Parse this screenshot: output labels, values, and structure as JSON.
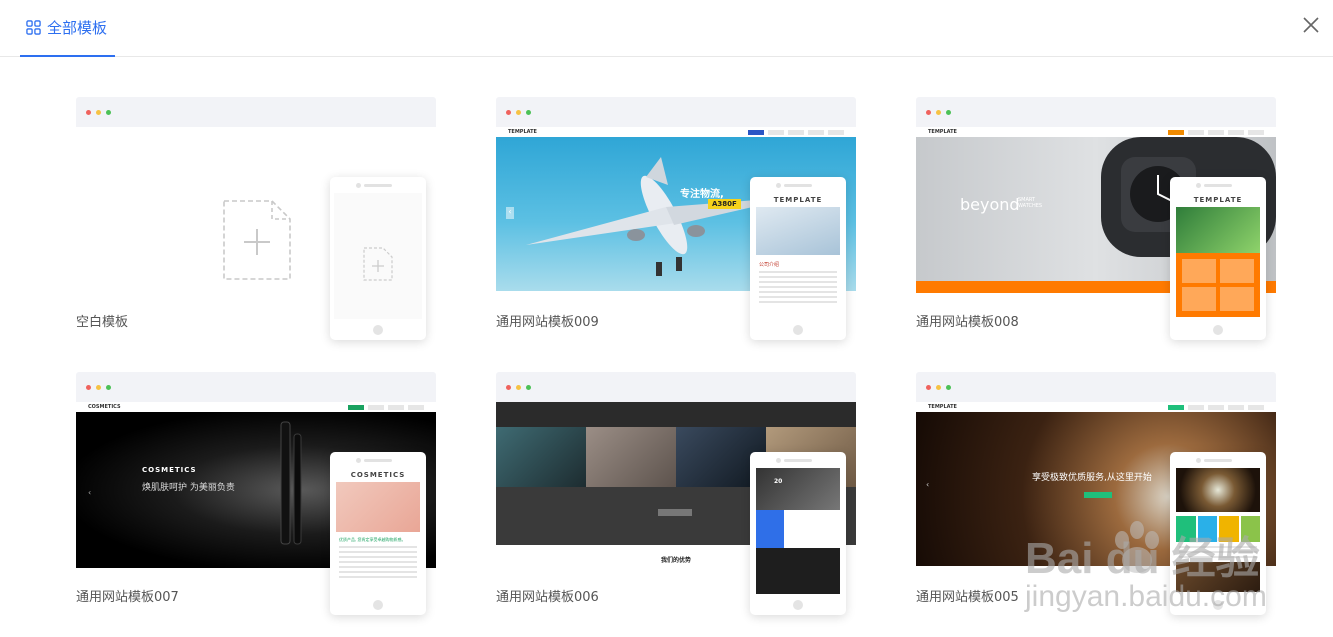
{
  "header": {
    "tab_label": "全部模板"
  },
  "templates": [
    {
      "label": "空白模板"
    },
    {
      "label": "通用网站模板009",
      "brand": "TEMPLATE",
      "hero_text": "专注物流,",
      "hero_tag": "A380F",
      "mobile_brand": "TEMPLATE",
      "mobile_heading": "公司介绍"
    },
    {
      "label": "通用网站模板008",
      "brand": "TEMPLATE",
      "hero_text": "beyond",
      "hero_sub": "SMART WATCHES",
      "mobile_brand": "TEMPLATE"
    },
    {
      "label": "通用网站模板007",
      "brand": "COSMETICS",
      "hero_title": "COSMETICS",
      "hero_text": "焕肌肤呵护 为美丽负责",
      "mobile_brand": "COSMETICS",
      "mobile_heading": "优质产品, 您肯定享受卓越购物质感。"
    },
    {
      "label": "通用网站模板006",
      "section_title": "我们的优势",
      "mobile_num": "20"
    },
    {
      "label": "通用网站模板005",
      "brand": "TEMPLATE",
      "hero_text": "享受极致优质服务,从这里开始"
    }
  ],
  "watermark": {
    "logo": "Bai du 经验",
    "url": "jingyan.baidu.com"
  },
  "colors": {
    "accent": "#2d6ff0",
    "dot_red": "#f0625d",
    "dot_yellow": "#f6c243",
    "dot_green": "#4cc156"
  }
}
